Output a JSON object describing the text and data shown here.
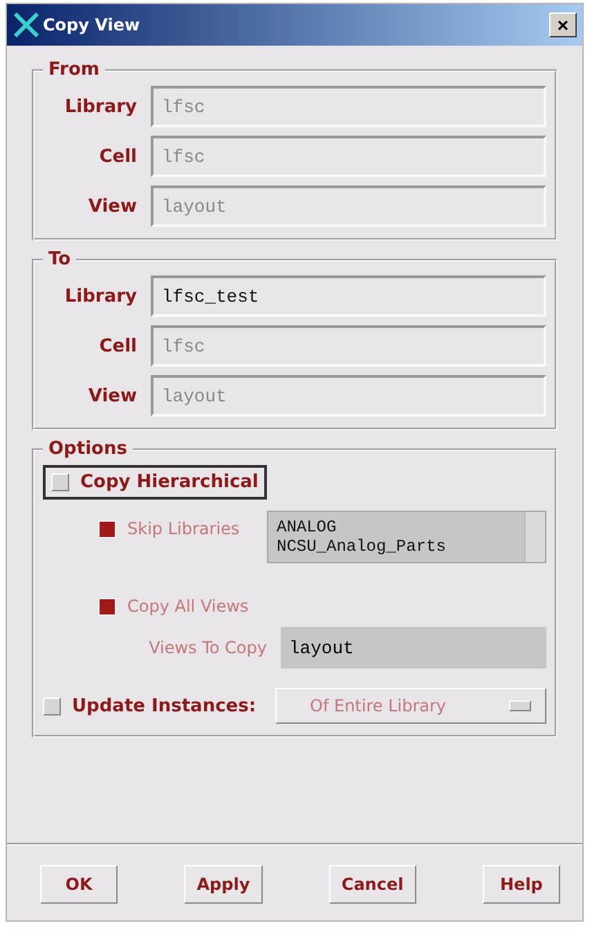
{
  "window": {
    "title": "Copy View",
    "close": "×"
  },
  "groups": [
    {
      "title": "From",
      "fields": [
        {
          "label": "Library",
          "value": "lfsc",
          "disabled": true
        },
        {
          "label": "Cell",
          "value": "lfsc",
          "disabled": true
        },
        {
          "label": "View",
          "value": "layout",
          "disabled": true
        }
      ]
    },
    {
      "title": "To",
      "fields": [
        {
          "label": "Library",
          "value": "lfsc_test",
          "disabled": false
        },
        {
          "label": "Cell",
          "value": "lfsc",
          "disabled": true
        },
        {
          "label": "View",
          "value": "layout",
          "disabled": true
        }
      ]
    }
  ],
  "options": {
    "title": "Options",
    "copy_hierarchical": {
      "label": "Copy Hierarchical",
      "checked": false
    },
    "skip_libraries": {
      "label": "Skip Libraries",
      "checked": true,
      "disabled": true,
      "items": [
        "ANALOG",
        "NCSU_Analog_Parts"
      ]
    },
    "copy_all_views": {
      "label": "Copy All Views",
      "checked": true,
      "disabled": true
    },
    "views_to_copy": {
      "label": "Views To Copy",
      "value": "layout",
      "disabled": true
    },
    "update_instances": {
      "label": "Update Instances:",
      "checked": false,
      "dropdown": "Of Entire Library",
      "dropdown_disabled": true
    }
  },
  "buttons": [
    "OK",
    "Apply",
    "Cancel",
    "Help"
  ]
}
